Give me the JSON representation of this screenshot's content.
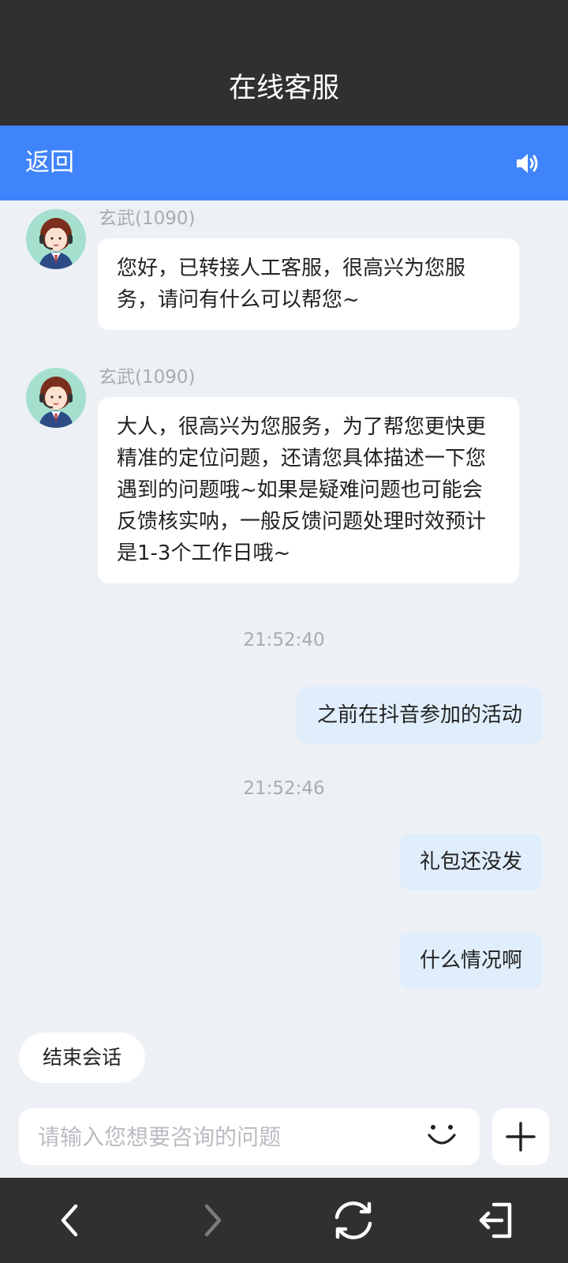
{
  "header": {
    "title": "在线客服"
  },
  "navbar": {
    "back_label": "返回",
    "speaker_icon": "speaker-icon"
  },
  "messages": [
    {
      "sender": "玄武(1090)",
      "text": "您好，已转接人工客服，很高兴为您服务，请问有什么可以帮您~"
    },
    {
      "sender": "玄武(1090)",
      "text": "大人，很高兴为您服务，为了帮您更快更精准的定位问题，还请您具体描述一下您遇到的问题哦~如果是疑难问题也可能会反馈核实呐，一般反馈问题处理时效预计是1-3个工作日哦~"
    }
  ],
  "timestamps": [
    "21:52:40",
    "21:52:46"
  ],
  "user_messages": [
    "之前在抖音参加的活动",
    "礼包还没发",
    "什么情况啊"
  ],
  "end_session_label": "结束会话",
  "input": {
    "placeholder": "请输入您想要咨询的问题",
    "value": ""
  },
  "colors": {
    "header_bg": "#303030",
    "accent": "#4084fb",
    "chat_bg": "#edf1f5",
    "user_bubble": "#e0eefc"
  },
  "bottom_nav": {
    "icons": [
      "back-arrow-icon",
      "forward-arrow-icon",
      "refresh-icon",
      "exit-icon"
    ]
  }
}
